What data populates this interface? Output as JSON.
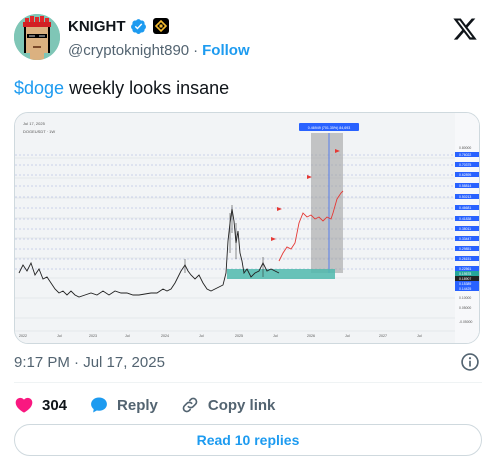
{
  "author": {
    "display_name": "KNIGHT",
    "handle": "@cryptoknight890",
    "separator": "·",
    "follow_label": "Follow"
  },
  "tweet": {
    "cashtag": "$doge",
    "text": " weekly looks insane"
  },
  "chart_image": {
    "info_line": "Jul 17, 2025",
    "header_line": "DOGEUSDT  ·  1W",
    "measure_label": "0.46949 (701.35%) 84,693",
    "price_labels": [
      "0.80000",
      "0.76022",
      "0.70375",
      "0.62895",
      "0.58814",
      "0.50213",
      "0.46681",
      "0.41838",
      "0.38011",
      "0.33447",
      "0.29851",
      "0.26151",
      "0.22561",
      "0.19578",
      "0.18907",
      "0.15389",
      "0.14425",
      "0.10000",
      "0.05000",
      "-0.05000"
    ],
    "date_labels": [
      "2022",
      "Jul",
      "2023",
      "Jul",
      "2024",
      "Jul",
      "2025",
      "Jul",
      "2026",
      "Jul",
      "2027",
      "Jul"
    ]
  },
  "meta": {
    "timestamp": "9:17 PM · Jul 17, 2025"
  },
  "actions": {
    "likes": "304",
    "reply_label": "Reply",
    "copy_link_label": "Copy link"
  },
  "read_replies_label": "Read 10 replies",
  "colors": {
    "accent": "#1d9bf0",
    "like": "#f91880",
    "text_muted": "#536471"
  }
}
